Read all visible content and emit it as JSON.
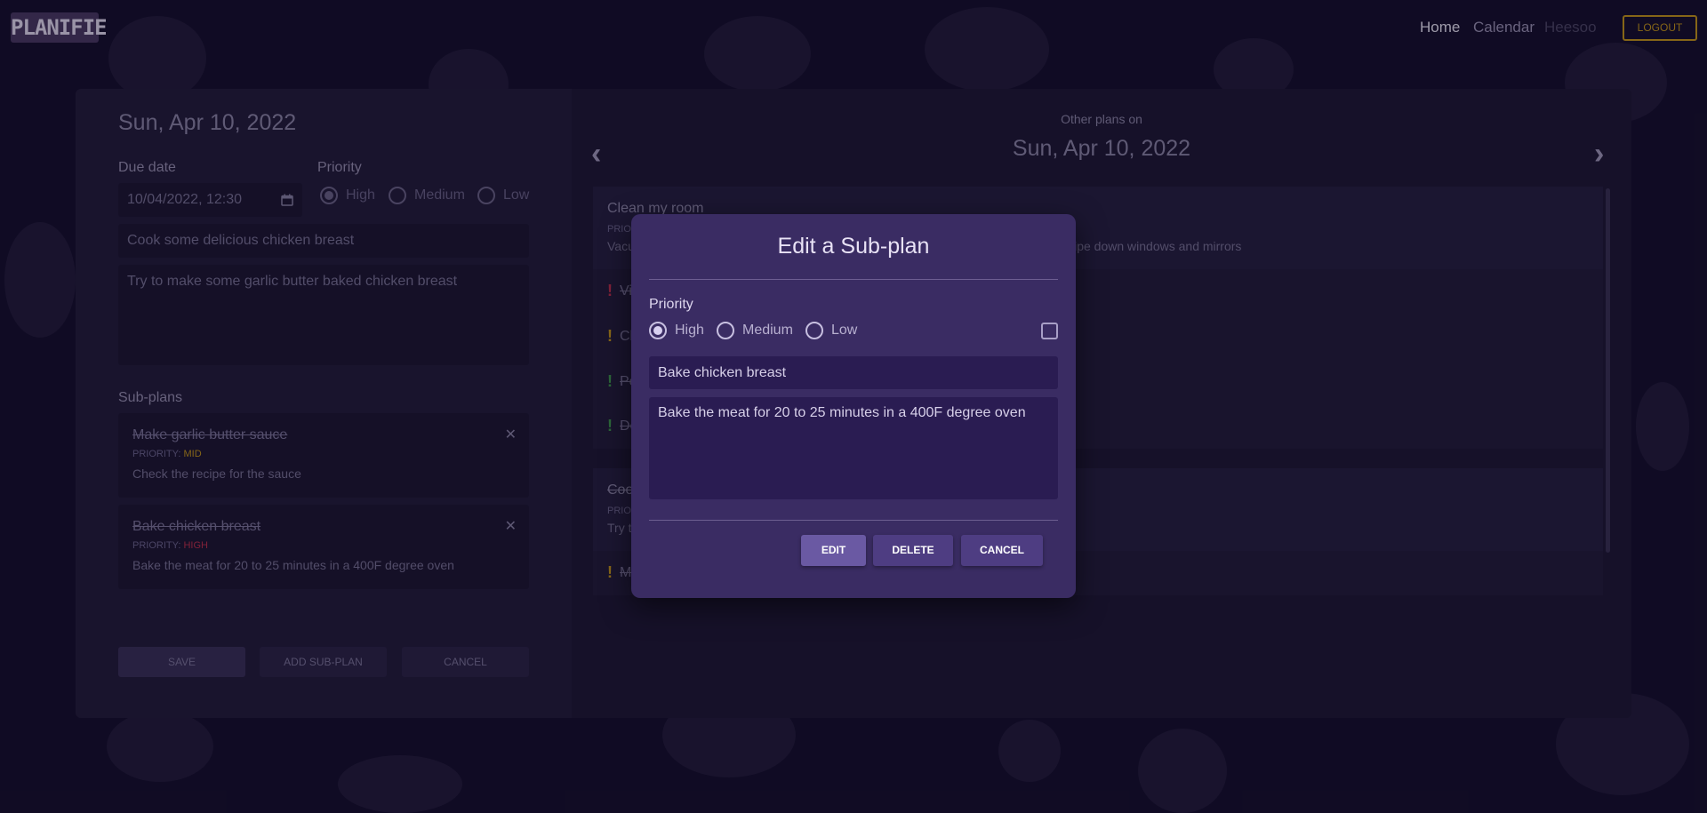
{
  "app": {
    "logo": "PLANIFIE"
  },
  "nav": {
    "home": "Home",
    "calendar": "Calendar",
    "user": "Heesoo",
    "logout": "LOGOUT"
  },
  "left": {
    "date_title": "Sun, Apr 10, 2022",
    "due_date_label": "Due date",
    "due_date_value": "10/04/2022, 12:30",
    "priority_label": "Priority",
    "priority_options": [
      "High",
      "Medium",
      "Low"
    ],
    "priority_selected": "High",
    "title_value": "Cook some delicious chicken breast",
    "description_value": "Try to make some garlic butter baked chicken breast",
    "subplans_label": "Sub-plans",
    "subplans": [
      {
        "title": "Make garlic butter sauce",
        "priority_prefix": "PRIORITY: ",
        "priority": "MID",
        "priority_color": "#c99a18",
        "description": "Check the recipe for the sauce"
      },
      {
        "title": "Bake chicken breast",
        "priority_prefix": "PRIORITY: ",
        "priority": "HIGH",
        "priority_color": "#c0304a",
        "description": "Bake the meat for 20 to 25 minutes in a 400F degree oven"
      }
    ],
    "buttons": {
      "save": "SAVE",
      "add_subplan": "ADD SUB-PLAN",
      "cancel": "CANCEL"
    }
  },
  "right": {
    "other_label": "Other plans on",
    "date": "Sun, Apr 10, 2022",
    "plans": [
      {
        "title": "Clean my room",
        "priority_prefix": "PRIOR",
        "description_start": "Vacu",
        "description_end": "wipe down windows and mirrors",
        "subplans": [
          {
            "text": "Vi",
            "color": "#c0304a"
          },
          {
            "text": "Cl",
            "color": "#c99a18"
          },
          {
            "text": "Pe",
            "color": "#3f9a4a"
          },
          {
            "text": "De",
            "color": "#3f9a4a"
          }
        ]
      },
      {
        "title": "Coo",
        "priority_prefix": "PRIOR",
        "description_start": "Try t",
        "subplans": [
          {
            "text": "M",
            "color": "#c99a18"
          }
        ]
      }
    ]
  },
  "modal": {
    "title": "Edit a Sub-plan",
    "priority_label": "Priority",
    "priority_options": [
      "High",
      "Medium",
      "Low"
    ],
    "priority_selected": "High",
    "completed_checked": false,
    "title_value": "Bake chicken breast",
    "description_value": "Bake the meat for 20 to 25 minutes in a 400F degree oven",
    "buttons": {
      "edit": "EDIT",
      "delete": "DELETE",
      "cancel": "CANCEL"
    }
  }
}
